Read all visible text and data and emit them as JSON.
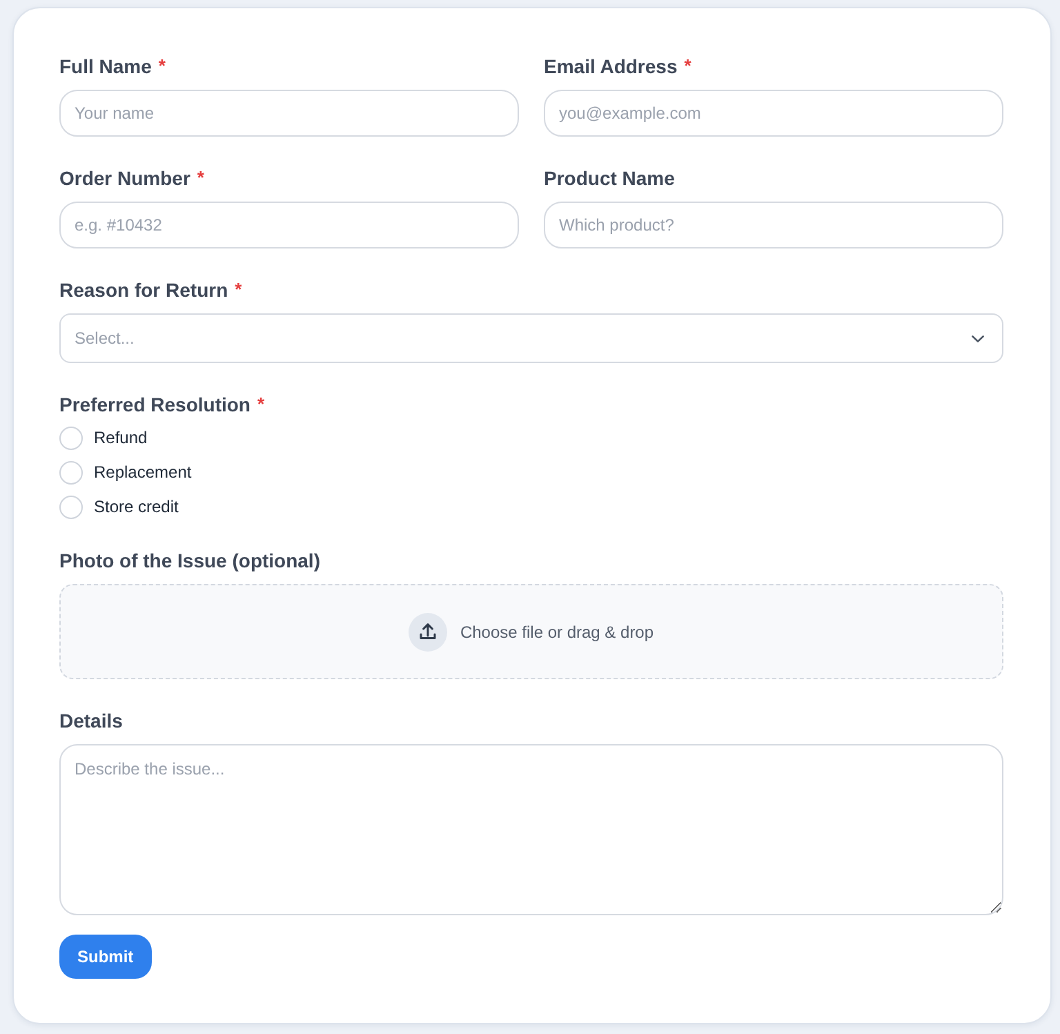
{
  "form": {
    "required_marker": "*",
    "rows": [
      {
        "fields": [
          {
            "kind": "text",
            "label": "Full Name",
            "required": true,
            "placeholder": "Your name"
          },
          {
            "kind": "text",
            "label": "Email Address",
            "required": true,
            "placeholder": "you@example.com"
          }
        ]
      },
      {
        "fields": [
          {
            "kind": "text",
            "label": "Order Number",
            "required": true,
            "placeholder": "e.g. #10432"
          },
          {
            "kind": "text",
            "label": "Product Name",
            "required": false,
            "placeholder": "Which product?"
          }
        ]
      },
      {
        "fields": [
          {
            "kind": "select",
            "label": "Reason for Return",
            "required": true,
            "placeholder": "Select..."
          }
        ]
      },
      {
        "fields": [
          {
            "kind": "radio",
            "label": "Preferred Resolution",
            "required": true,
            "options": [
              {
                "label": "Refund",
                "selected": false
              },
              {
                "label": "Replacement",
                "selected": false
              },
              {
                "label": "Store credit",
                "selected": false
              }
            ]
          }
        ]
      },
      {
        "fields": [
          {
            "kind": "file",
            "label": "Photo of the Issue (optional)",
            "required": false,
            "prompt": "Choose file or drag & drop"
          }
        ]
      },
      {
        "fields": [
          {
            "kind": "textarea",
            "label": "Details",
            "required": false,
            "placeholder": "Describe the issue..."
          }
        ]
      }
    ],
    "submit": {
      "label": "Submit"
    }
  }
}
